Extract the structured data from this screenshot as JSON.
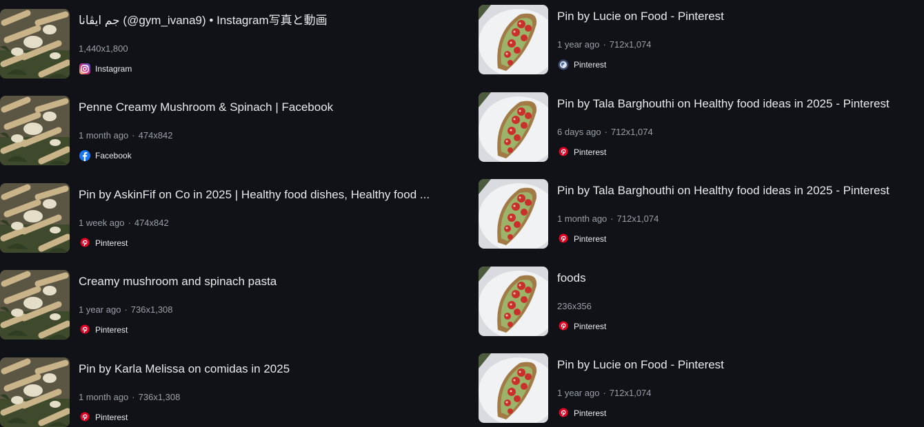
{
  "left_results": [
    {
      "title": "جم ايڤانا (@gym_ivana9) • Instagram写真と動画",
      "age": "",
      "dims": "1,440x1,800",
      "source": "Instagram",
      "icon": "instagram-icon"
    },
    {
      "title": "Penne Creamy Mushroom & Spinach | Facebook",
      "age": "1 month ago",
      "dims": "474x842",
      "source": "Facebook",
      "icon": "facebook-icon"
    },
    {
      "title": "Pin by AskinFif on Co in 2025 | Healthy food dishes, Healthy food ...",
      "age": "1 week ago",
      "dims": "474x842",
      "source": "Pinterest",
      "icon": "pinterest-icon"
    },
    {
      "title": "Creamy mushroom and spinach pasta",
      "age": "1 year ago",
      "dims": "736x1,308",
      "source": "Pinterest",
      "icon": "pinterest-icon"
    },
    {
      "title": "Pin by Karla Melissa on comidas in 2025",
      "age": "1 month ago",
      "dims": "736x1,308",
      "source": "Pinterest",
      "icon": "pinterest-icon"
    }
  ],
  "right_results": [
    {
      "title": "Pin by Lucie on Food - Pinterest",
      "age": "1 year ago",
      "dims": "712x1,074",
      "source": "Pinterest",
      "icon": "globe-icon"
    },
    {
      "title": "Pin by Tala Barghouthi on Healthy food ideas in 2025 - Pinterest",
      "age": "6 days ago",
      "dims": "712x1,074",
      "source": "Pinterest",
      "icon": "pinterest-icon"
    },
    {
      "title": "Pin by Tala Barghouthi on Healthy food ideas in 2025 - Pinterest",
      "age": "1 month ago",
      "dims": "712x1,074",
      "source": "Pinterest",
      "icon": "pinterest-icon"
    },
    {
      "title": "foods",
      "age": "",
      "dims": "236x356",
      "source": "Pinterest",
      "icon": "pinterest-icon"
    },
    {
      "title": "Pin by Lucie on Food - Pinterest",
      "age": "1 year ago",
      "dims": "712x1,074",
      "source": "Pinterest",
      "icon": "pinterest-icon"
    }
  ],
  "colors": {
    "background": "#101218",
    "title_text": "#e8eaed",
    "meta_text": "#9aa0a6",
    "pinterest": "#e60023",
    "facebook": "#1877f2"
  }
}
